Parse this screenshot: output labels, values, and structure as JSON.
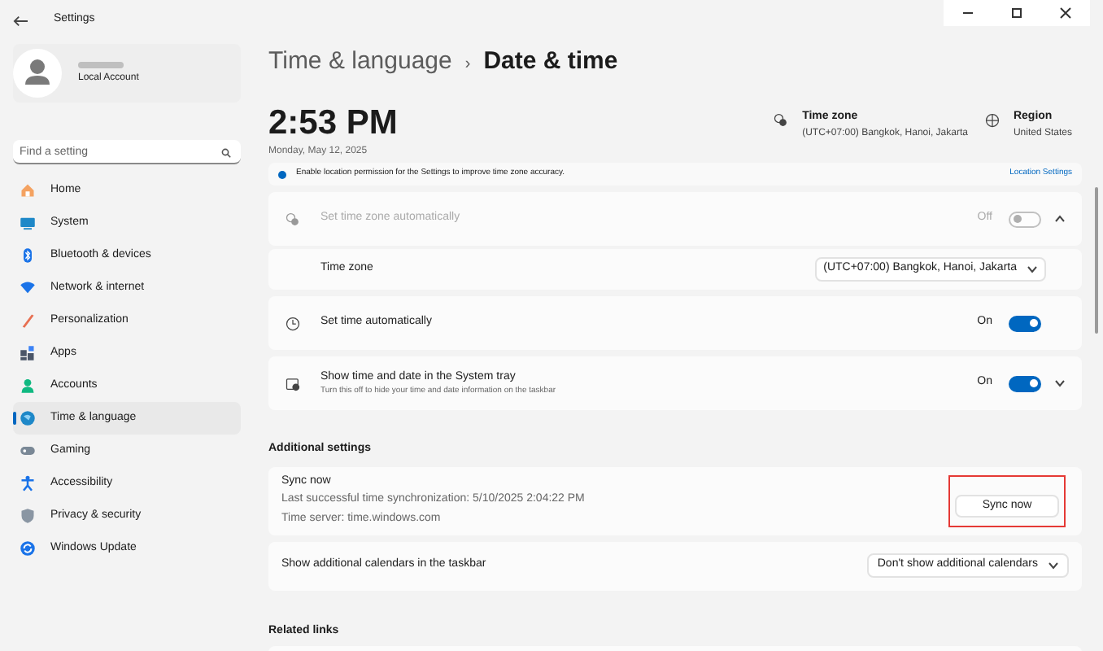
{
  "window": {
    "title": "Settings"
  },
  "account": {
    "type": "Local Account"
  },
  "search": {
    "placeholder": "Find a setting"
  },
  "nav": [
    {
      "label": "Home",
      "selected": false
    },
    {
      "label": "System",
      "selected": false
    },
    {
      "label": "Bluetooth & devices",
      "selected": false
    },
    {
      "label": "Network & internet",
      "selected": false
    },
    {
      "label": "Personalization",
      "selected": false
    },
    {
      "label": "Apps",
      "selected": false
    },
    {
      "label": "Accounts",
      "selected": false
    },
    {
      "label": "Time & language",
      "selected": true
    },
    {
      "label": "Gaming",
      "selected": false
    },
    {
      "label": "Accessibility",
      "selected": false
    },
    {
      "label": "Privacy & security",
      "selected": false
    },
    {
      "label": "Windows Update",
      "selected": false
    }
  ],
  "breadcrumb": {
    "parent": "Time & language",
    "separator": "›",
    "current": "Date & time"
  },
  "clock": {
    "time": "2:53 PM",
    "date": "Monday, May 12, 2025"
  },
  "summary": [
    {
      "label": "Time zone",
      "value": "(UTC+07:00) Bangkok, Hanoi, Jakarta"
    },
    {
      "label": "Region",
      "value": "United States"
    }
  ],
  "banner": {
    "text": "Enable location permission for the Settings to improve time zone accuracy.",
    "link": "Location Settings"
  },
  "settings": [
    {
      "kind": "toggle",
      "label": "Set time zone automatically",
      "disabled": true,
      "on": false,
      "state_text": "Off",
      "expanded": true
    },
    {
      "kind": "dropdown",
      "label": "Time zone",
      "value": "(UTC+07:00) Bangkok, Hanoi, Jakarta"
    },
    {
      "kind": "toggle",
      "label": "Set time automatically",
      "disabled": false,
      "on": true,
      "state_text": "On"
    },
    {
      "kind": "toggle",
      "label": "Show time and date in the System tray",
      "description": "Turn this off to hide your time and date information on the taskbar",
      "disabled": false,
      "on": true,
      "state_text": "On",
      "expanded": false
    }
  ],
  "additional": {
    "heading": "Additional settings",
    "sync": {
      "title": "Sync now",
      "last": "Last successful time synchronization: 5/10/2025 2:04:22 PM",
      "server": "Time server: time.windows.com",
      "button": "Sync now",
      "highlighted": true
    },
    "calendars": {
      "label": "Show additional calendars in the taskbar",
      "value": "Don't show additional calendars"
    }
  },
  "related": {
    "heading": "Related links"
  }
}
